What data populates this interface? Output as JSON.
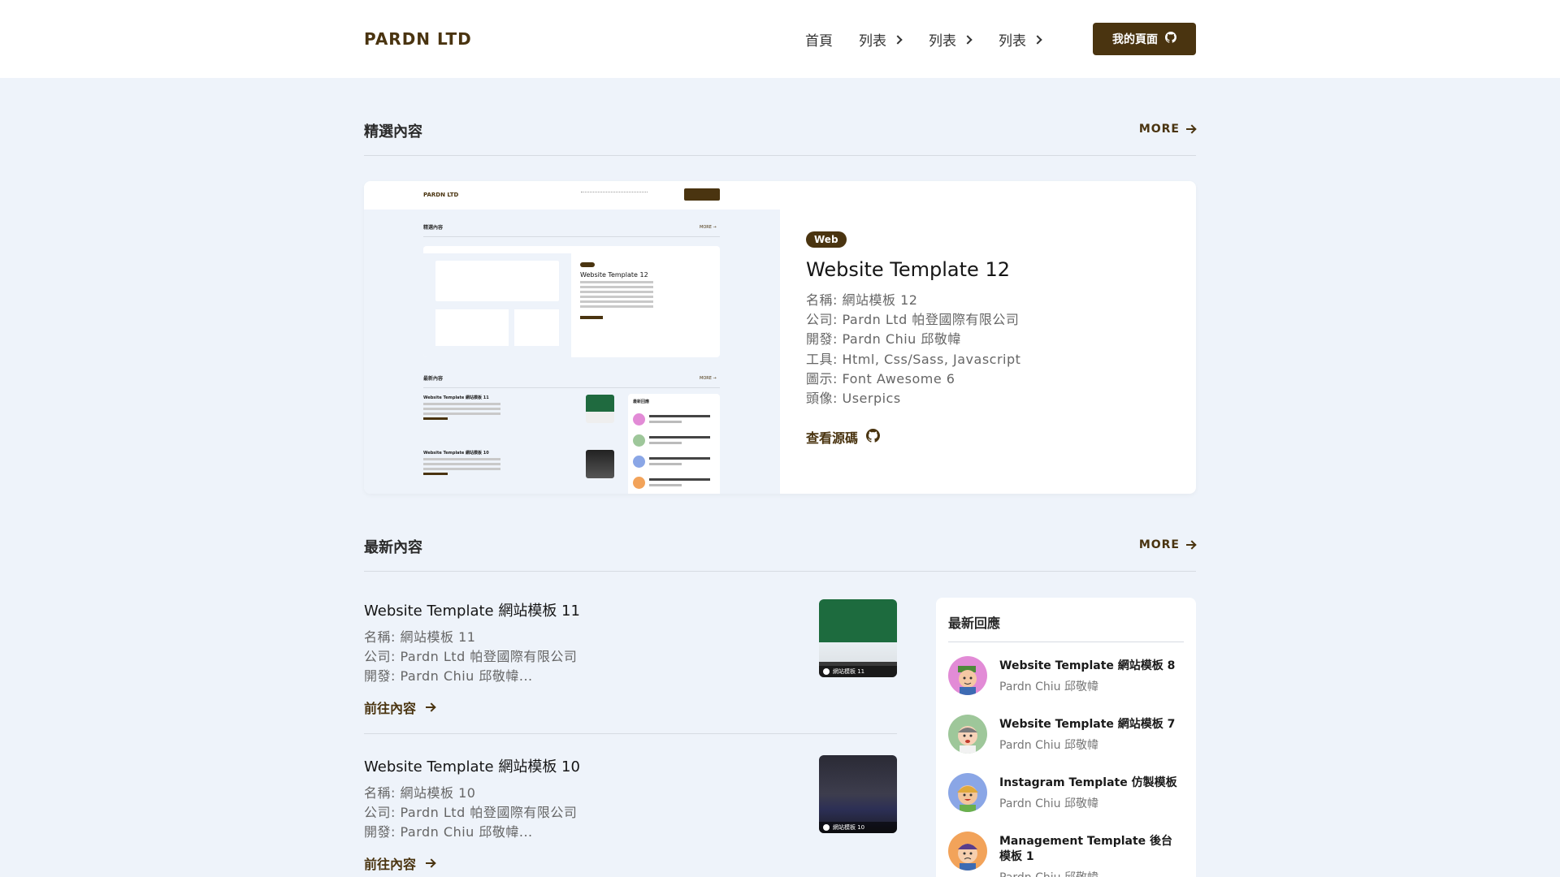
{
  "header": {
    "brand": "PARDN LTD",
    "nav": [
      "首頁",
      "列表",
      "列表",
      "列表"
    ],
    "mypage_label": "我的頁面"
  },
  "featured_section": {
    "title": "精選內容",
    "more_label": "MORE",
    "card": {
      "badge": "Web",
      "title": "Website Template 12",
      "lines": [
        "名稱: 網站模板 12",
        "公司: Pardn Ltd 帕登國際有限公司",
        "開發: Pardn Chiu 邱敬幃",
        "工具: Html, Css/Sass, Javascript",
        "圖示: Font Awesome 6",
        "頭像: Userpics"
      ],
      "source_label": "查看源碼",
      "screenshot": {
        "brand": "PARDN LTD",
        "featured_title": "精選內容",
        "latest_title": "最新內容",
        "more": "MORE →",
        "card_badge": "Web",
        "card_title": "Website Template 12",
        "items": [
          "Website Template 網站模板 11",
          "Website Template 網站模板 10"
        ],
        "side_title": "最新回應"
      }
    }
  },
  "latest_section": {
    "title": "最新內容",
    "more_label": "MORE",
    "posts": [
      {
        "title": "Website Template 網站模板 11",
        "lines": [
          "名稱: 網站模板 11",
          "公司: Pardn Ltd 帕登國際有限公司",
          "開發: Pardn Chiu 邱敬幃..."
        ],
        "link_label": "前往內容",
        "thumb_caption": "網站模板 11"
      },
      {
        "title": "Website Template 網站模板 10",
        "lines": [
          "名稱: 網站模板 10",
          "公司: Pardn Ltd 帕登國際有限公司",
          "開發: Pardn Chiu 邱敬幃..."
        ],
        "link_label": "前往內容",
        "thumb_caption": "網站模板 10"
      }
    ]
  },
  "replies": {
    "title": "最新回應",
    "items": [
      {
        "title": "Website Template 網站模板 8",
        "author": "Pardn Chiu 邱敬幃",
        "avatar_color": "#e28bd6"
      },
      {
        "title": "Website Template 網站模板 7",
        "author": "Pardn Chiu 邱敬幃",
        "avatar_color": "#9ec79a"
      },
      {
        "title": "Instagram Template 仿製模板",
        "author": "Pardn Chiu 邱敬幃",
        "avatar_color": "#8aa6e6"
      },
      {
        "title": "Management Template 後台模板 1",
        "author": "Pardn Chiu 邱敬幃",
        "avatar_color": "#f2a35a"
      }
    ]
  },
  "colors": {
    "brand": "#4a3410",
    "page_bg": "#eef3fa"
  }
}
